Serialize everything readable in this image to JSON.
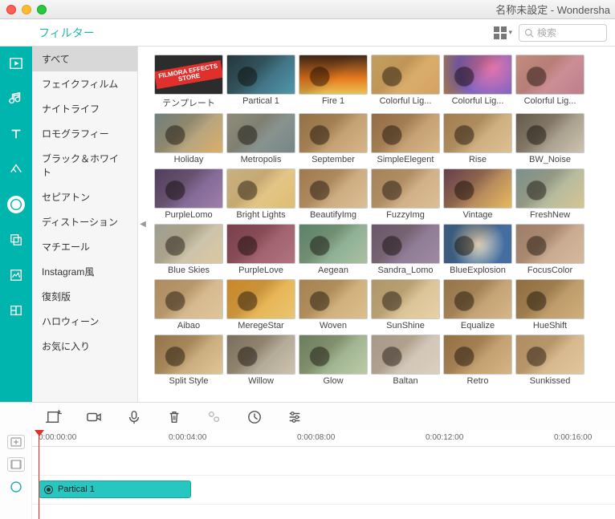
{
  "window_title": "名称未設定 - Wondersha",
  "section_title": "フィルター",
  "search_placeholder": "検索",
  "categories": [
    {
      "label": "すべて",
      "active": true
    },
    {
      "label": "フェイクフィルム"
    },
    {
      "label": "ナイトライフ"
    },
    {
      "label": "ロモグラフィー"
    },
    {
      "label": "ブラック＆ホワイト"
    },
    {
      "label": "セピアトン"
    },
    {
      "label": "ディストーション"
    },
    {
      "label": "マチエール"
    },
    {
      "label": "Instagram風"
    },
    {
      "label": "復刻版"
    },
    {
      "label": "ハロウィーン"
    },
    {
      "label": "お気に入り"
    }
  ],
  "sidebar_icons": [
    {
      "name": "media-icon"
    },
    {
      "name": "music-icon"
    },
    {
      "name": "text-icon"
    },
    {
      "name": "transitions-icon"
    },
    {
      "name": "filters-icon",
      "active": true
    },
    {
      "name": "overlays-icon"
    },
    {
      "name": "elements-icon"
    },
    {
      "name": "splitscreen-icon"
    }
  ],
  "filters": [
    {
      "label": "テンプレート",
      "style": "th0",
      "badge": "FILMORA EFFECTS STORE"
    },
    {
      "label": "Partical 1",
      "tint": "linear-gradient(135deg,#0a2a4a,#3aa0d8)"
    },
    {
      "label": "Fire 1",
      "tint": "linear-gradient(#2a1000,#ff7a00 60%,#ffdd55)"
    },
    {
      "label": "Colorful Lig...",
      "tint": "linear-gradient(135deg,#f7d78a,#e8b06a)"
    },
    {
      "label": "Colorful Lig...",
      "tint": "radial-gradient(circle at 70% 30%,#ff74d8,#7a5cff 60%,#c79a6a)"
    },
    {
      "label": "Colorful Lig...",
      "tint": "linear-gradient(135deg,#f5b8c8,#c97eaa)"
    },
    {
      "label": "Holiday",
      "tint": "linear-gradient(135deg,#7aa6c9,#f0c070)"
    },
    {
      "label": "Metropolis",
      "tint": "linear-gradient(135deg,#aab6be,#6a8aa0)"
    },
    {
      "label": "September",
      "tint": "linear-gradient(135deg,#b08a5a,#e8caa0)"
    },
    {
      "label": "SimpleElegent",
      "tint": "linear-gradient(135deg,#b0825a,#eacc9e)"
    },
    {
      "label": "Rise",
      "tint": "linear-gradient(135deg,#c4a070,#f0dab0)"
    },
    {
      "label": "BW_Noise",
      "tint": "linear-gradient(135deg,#666,#ddd)"
    },
    {
      "label": "PurpleLomo",
      "tint": "linear-gradient(135deg,#4a3a8a,#a080d8)"
    },
    {
      "label": "Bright Lights",
      "tint": "linear-gradient(135deg,#fff3d0,#f5d680)"
    },
    {
      "label": "BeautifyImg",
      "tint": "linear-gradient(135deg,#c29a6a,#f0d8b8)"
    },
    {
      "label": "FuzzyImg",
      "tint": "linear-gradient(135deg,#caa880,#f0d8b8)"
    },
    {
      "label": "Vintage",
      "tint": "linear-gradient(135deg,#6a3a6a,#ffd060)"
    },
    {
      "label": "FreshNew",
      "tint": "linear-gradient(135deg,#88c0e8,#e8e0b0)"
    },
    {
      "label": "Blue Skies",
      "tint": "linear-gradient(135deg,#c0d8f0,#f0e4c8)"
    },
    {
      "label": "PurpleLove",
      "tint": "linear-gradient(135deg,#8a3a6a,#b87090)"
    },
    {
      "label": "Aegean",
      "tint": "linear-gradient(135deg,#5aa8a0,#b0d8c8)"
    },
    {
      "label": "Sandra_Lomo",
      "tint": "linear-gradient(135deg,#7060a0,#a090c8)"
    },
    {
      "label": "BlueExplosion",
      "tint": "radial-gradient(circle at 50% 50%,#fff,#2a6ac8 70%)"
    },
    {
      "label": "FocusColor",
      "tint": "linear-gradient(135deg,#bfa0a0,#e8d0c0)"
    },
    {
      "label": "Aibao",
      "tint": "linear-gradient(135deg,#d8b890,#f5e0c0)"
    },
    {
      "label": "MeregeStar",
      "tint": "linear-gradient(135deg,#ffb020,#ffe080)"
    },
    {
      "label": "Woven",
      "tint": "linear-gradient(135deg,#caa870,#f0d8a8)"
    },
    {
      "label": "SunShine",
      "tint": "linear-gradient(135deg,#d8c8a0,#fff0d0)"
    },
    {
      "label": "Equalize",
      "tint": "linear-gradient(135deg,#b09060,#e8caa0)"
    },
    {
      "label": "HueShift",
      "tint": "linear-gradient(135deg,#a88850,#e0c090)"
    },
    {
      "label": "Split Style",
      "tint": "linear-gradient(135deg,#b09060,#f5e0b8)"
    },
    {
      "label": "Willow",
      "tint": "linear-gradient(135deg,#888,#ddd)"
    },
    {
      "label": "Glow",
      "tint": "linear-gradient(135deg,#70a08a,#c8e8d0)"
    },
    {
      "label": "Baltan",
      "tint": "linear-gradient(135deg,#ccccdd,#f0f0f5)"
    },
    {
      "label": "Retro",
      "tint": "linear-gradient(135deg,#b08a5a,#e8c89a)"
    },
    {
      "label": "Sunkissed",
      "tint": "linear-gradient(135deg,#d8b890,#f8e0c0)"
    }
  ],
  "tools": [
    {
      "name": "crop-tool"
    },
    {
      "name": "record-tool"
    },
    {
      "name": "voiceover-tool"
    },
    {
      "name": "delete-tool"
    },
    {
      "name": "settings-tool"
    },
    {
      "name": "speed-tool"
    },
    {
      "name": "tune-tool"
    }
  ],
  "timeline": {
    "ticks": [
      "0:00:00:00",
      "0:00:04:00",
      "0:00:08:00",
      "0:00:12:00",
      "0:00:16:00"
    ],
    "clip_label": "Partical 1"
  }
}
